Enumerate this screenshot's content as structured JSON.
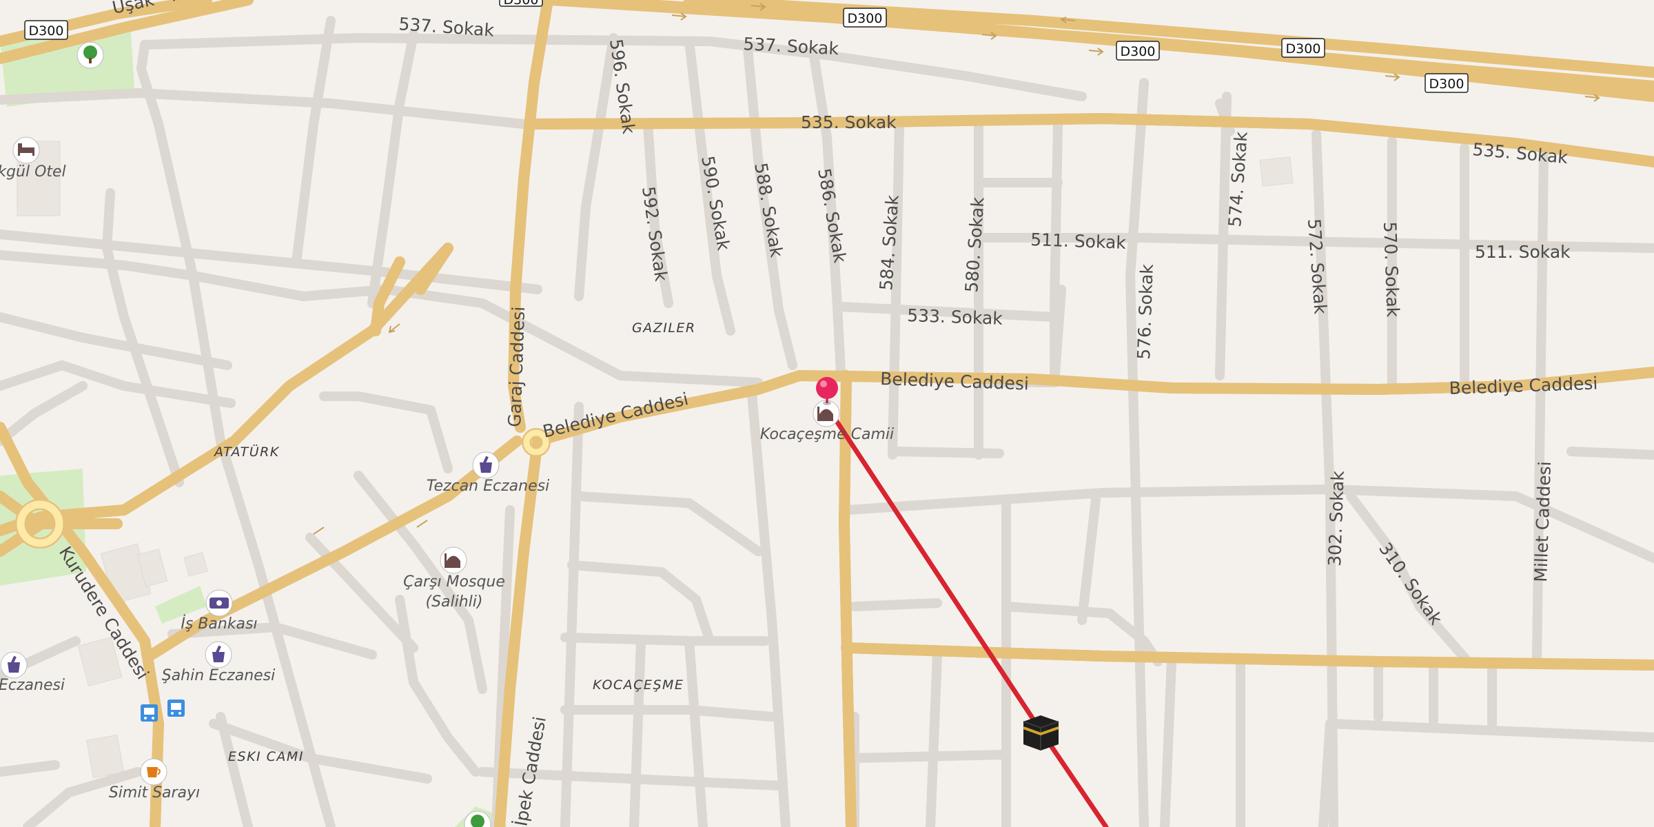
{
  "map": {
    "colors": {
      "background": "#f4f1ed",
      "minor_road": "#ffffff",
      "minor_road_casing": "#dcd7d1",
      "major_road": "#fde9a8",
      "major_road_casing": "#e8c379",
      "park": "#d5ecc2",
      "building": "#ebe5df",
      "route_line": "#d8242f",
      "pin": "#e8265e",
      "poi_icon": "#5b4a8f"
    },
    "road_shields": [
      "D300",
      "D300",
      "D300",
      "D300",
      "D300",
      "D300"
    ],
    "street_labels": {
      "s537_a": "537. Sokak",
      "s537_b": "537. Sokak",
      "s535_a": "535. Sokak",
      "s535_b": "535. Sokak",
      "s596": "596. Sokak",
      "s592": "592. Sokak",
      "s590": "590. Sokak",
      "s588": "588. Sokak",
      "s586": "586. Sokak",
      "s584": "584. Sokak",
      "s580": "580. Sokak",
      "s574": "574. Sokak",
      "s572": "572. Sokak",
      "s570": "570. Sokak",
      "s511_a": "511. Sokak",
      "s511_b": "511. Sokak",
      "s533": "533. Sokak",
      "s576": "576. Sokak",
      "s302": "302. Sokak",
      "s310": "310. Sokak",
      "belediye_a": "Belediye Caddesi",
      "belediye_b": "Belediye Caddesi",
      "belediye_c": "Belediye Caddesi",
      "garaj": "Garaj Caddesi",
      "kurudere": "Kurudere Caddesi",
      "millet": "Millet Caddesi",
      "ipek": "İpek Caddesi",
      "usak": "Uşak - İzmir"
    },
    "districts": {
      "gaziler": "GAZILER",
      "ataturk": "ATATÜRK",
      "kocacesme": "KOCAÇEŞME",
      "eski_cami": "ESKI CAMI"
    },
    "pois": {
      "kocacesme_camii": "Kocaçeşme Camii",
      "tezcan_eczanesi": "Tezcan Eczanesi",
      "carsi_mosque_1": "Çarşı Mosque",
      "carsi_mosque_2": "(Salihli)",
      "is_bankasi": "İş Bankası",
      "sahin_eczanesi": "Şahin Eczanesi",
      "eczanesi": "Eczanesi",
      "simit_sarayi": "Simit Sarayı",
      "otel": "kgül Otel"
    },
    "icons": {
      "pin": "location-pin-icon",
      "route_target": "kaaba-icon",
      "mosque": "mosque-icon",
      "pharmacy": "pharmacy-icon",
      "bank": "bank-icon",
      "bus": "bus-stop-icon",
      "cafe": "cafe-icon",
      "park": "park-tree-icon",
      "hotel": "hotel-icon"
    }
  }
}
